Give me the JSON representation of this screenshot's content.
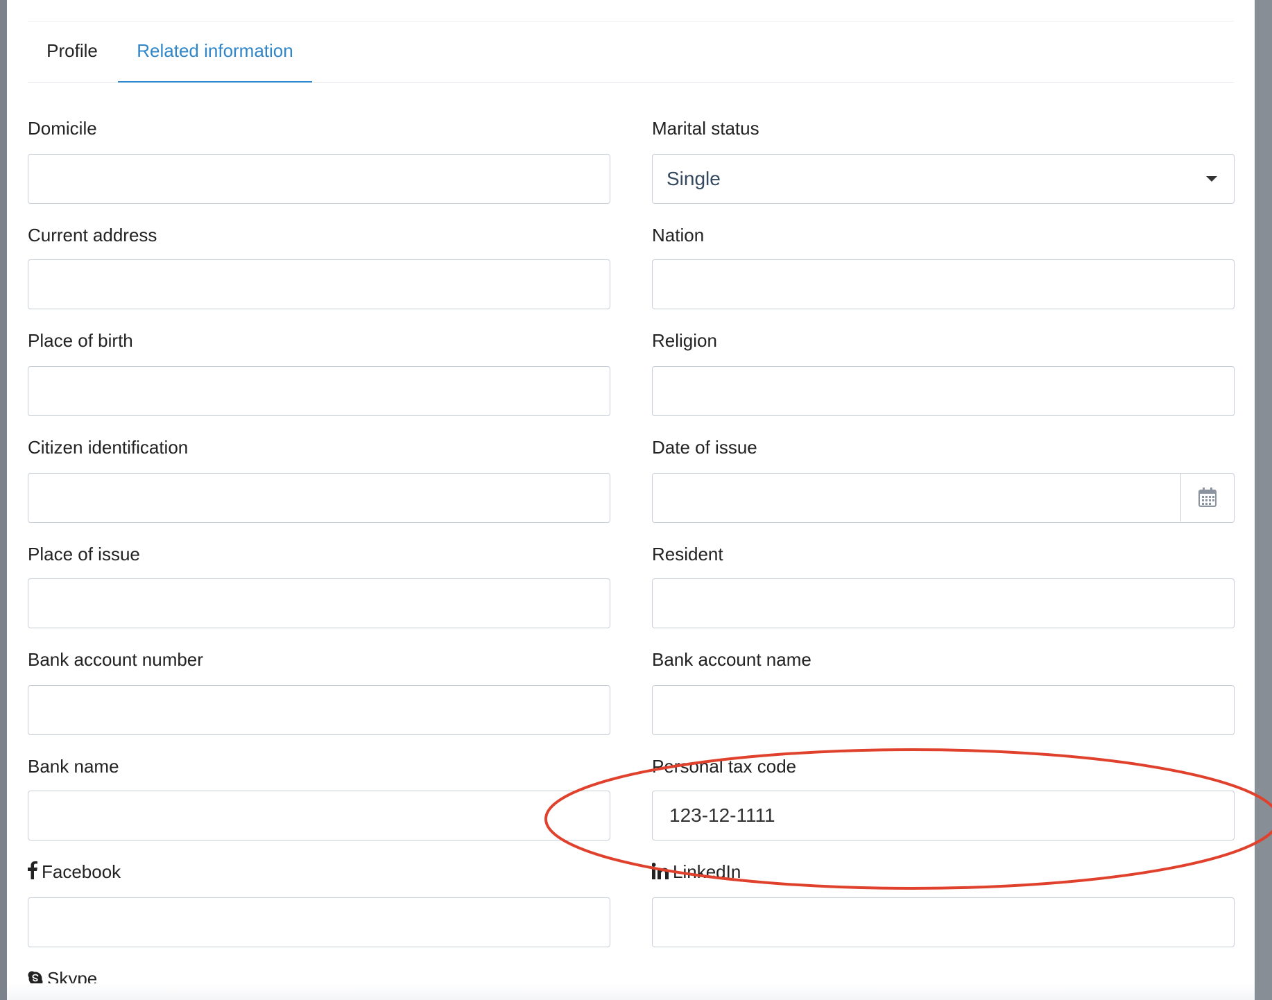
{
  "tabs": [
    {
      "label": "Profile",
      "active": false
    },
    {
      "label": "Related information",
      "active": true
    }
  ],
  "fields": {
    "domicile": {
      "label": "Domicile",
      "value": ""
    },
    "marital_status": {
      "label": "Marital status",
      "value": "Single"
    },
    "current_address": {
      "label": "Current address",
      "value": ""
    },
    "nation": {
      "label": "Nation",
      "value": ""
    },
    "place_of_birth": {
      "label": "Place of birth",
      "value": ""
    },
    "religion": {
      "label": "Religion",
      "value": ""
    },
    "citizen_identification": {
      "label": "Citizen identification",
      "value": ""
    },
    "date_of_issue": {
      "label": "Date of issue",
      "value": "",
      "icon": "calendar-icon"
    },
    "place_of_issue": {
      "label": "Place of issue",
      "value": ""
    },
    "resident": {
      "label": "Resident",
      "value": ""
    },
    "bank_account_number": {
      "label": "Bank account number",
      "value": ""
    },
    "bank_account_name": {
      "label": "Bank account name",
      "value": ""
    },
    "bank_name": {
      "label": "Bank name",
      "value": ""
    },
    "personal_tax_code": {
      "label": "Personal tax code",
      "value": "123-12-1111"
    },
    "facebook": {
      "label": "Facebook",
      "value": "",
      "icon": "facebook-icon"
    },
    "linkedin": {
      "label": "LinkedIn",
      "value": "",
      "icon": "linkedin-icon"
    },
    "skype": {
      "label": "Skype",
      "icon": "skype-icon"
    }
  },
  "colors": {
    "accent": "#2f86c9",
    "input_border": "#c7ced8",
    "annotation": "#e0412c"
  }
}
